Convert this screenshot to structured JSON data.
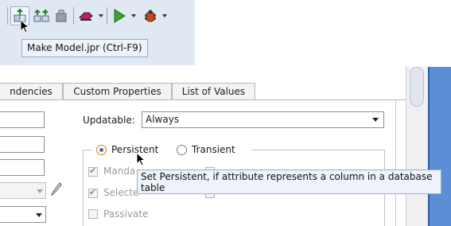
{
  "toolbar": {
    "buttons": [
      {
        "name": "make-icon"
      },
      {
        "name": "rebuild-icon"
      },
      {
        "name": "deploy-icon"
      },
      {
        "name": "bookmark-icon"
      },
      {
        "name": "run-icon"
      },
      {
        "name": "debug-icon"
      }
    ],
    "tooltip": "Make Model.jpr (Ctrl-F9)"
  },
  "tabs": [
    {
      "label": "ndencies"
    },
    {
      "label": "Custom Properties"
    },
    {
      "label": "List of Values"
    }
  ],
  "form": {
    "updatable_label": "Updatable:",
    "updatable_value": "Always",
    "persistent_label": "Persistent",
    "transient_label": "Transient",
    "persistence_selected": "Persistent",
    "checkboxes": [
      {
        "label": "Manda",
        "checked": true
      },
      {
        "label": "Selecte",
        "checked": true
      },
      {
        "label": "Passivate",
        "checked": false
      }
    ]
  },
  "tooltip2": "Set Persistent, if attribute represents a column in a database table",
  "colors": {
    "accent": "#5b8ed4",
    "toolbar_bg": "#dfe8f3"
  }
}
